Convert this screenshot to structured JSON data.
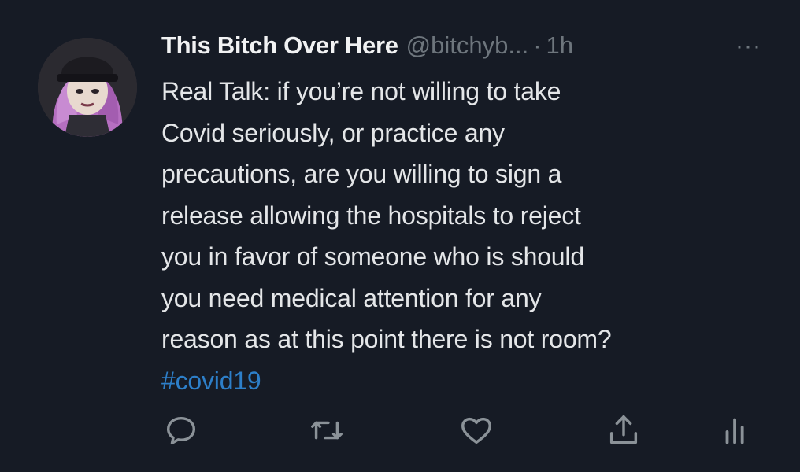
{
  "tweet": {
    "display_name": "This Bitch Over Here",
    "handle": "@bitchyb...",
    "separator": "·",
    "time": "1h",
    "more": "···",
    "body_lines": [
      "Real Talk: if you’re not willing to take",
      "Covid seriously, or practice any",
      "precautions, are you willing to sign a",
      "release allowing the hospitals to reject",
      "you in favor of someone who is should",
      "you need medical attention for any",
      "reason as at this point there is not room?"
    ],
    "hashtag": "#covid19"
  },
  "actions": [
    {
      "icon": "reply-icon"
    },
    {
      "icon": "retweet-icon"
    },
    {
      "icon": "like-icon"
    },
    {
      "icon": "share-icon"
    },
    {
      "icon": "analytics-icon"
    }
  ],
  "colors": {
    "background": "#161b25",
    "text": "#e4e6e8",
    "muted": "#6e767d",
    "link": "#2d7fc9"
  }
}
